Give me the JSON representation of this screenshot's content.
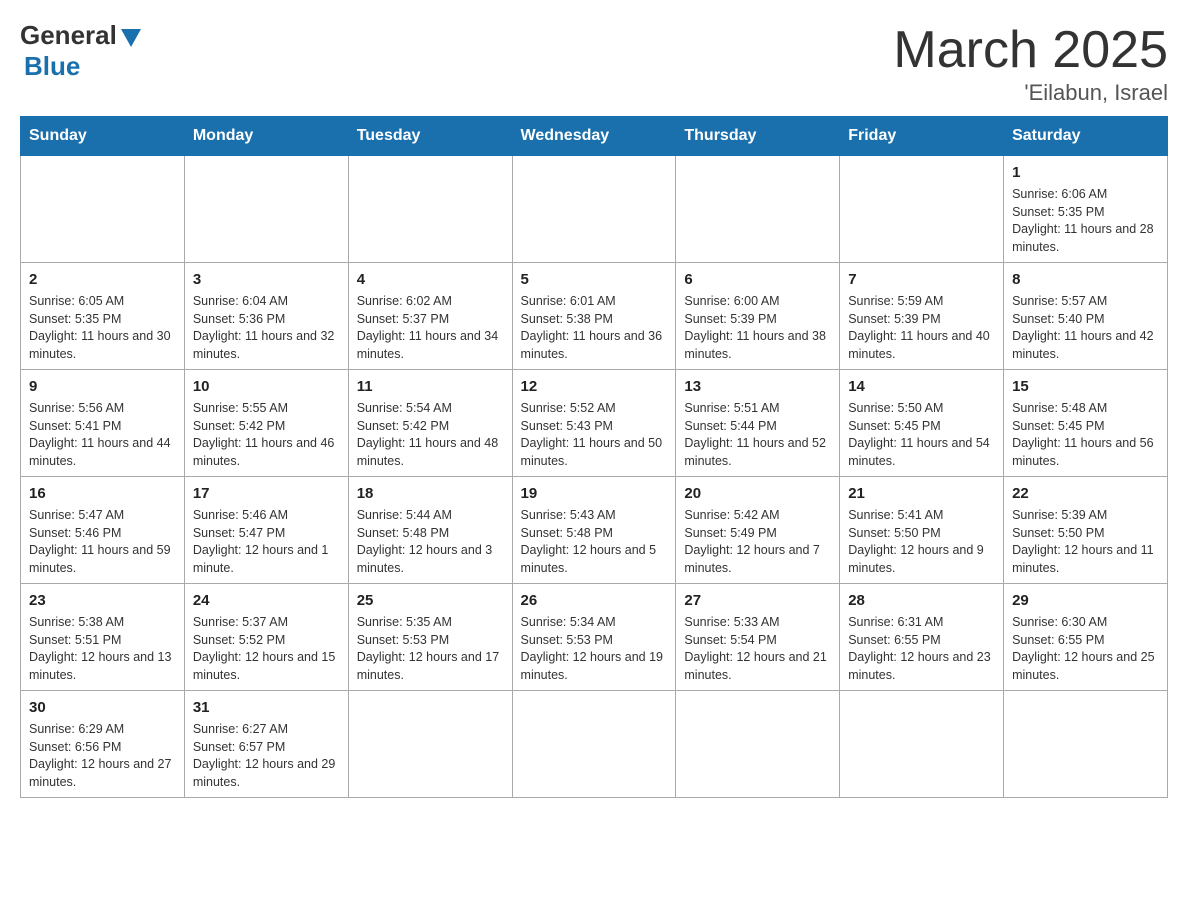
{
  "header": {
    "logo_general": "General",
    "logo_blue": "Blue",
    "month_title": "March 2025",
    "location": "'Eilabun, Israel"
  },
  "weekdays": [
    "Sunday",
    "Monday",
    "Tuesday",
    "Wednesday",
    "Thursday",
    "Friday",
    "Saturday"
  ],
  "weeks": [
    [
      {
        "day": "",
        "sunrise": "",
        "sunset": "",
        "daylight": ""
      },
      {
        "day": "",
        "sunrise": "",
        "sunset": "",
        "daylight": ""
      },
      {
        "day": "",
        "sunrise": "",
        "sunset": "",
        "daylight": ""
      },
      {
        "day": "",
        "sunrise": "",
        "sunset": "",
        "daylight": ""
      },
      {
        "day": "",
        "sunrise": "",
        "sunset": "",
        "daylight": ""
      },
      {
        "day": "",
        "sunrise": "",
        "sunset": "",
        "daylight": ""
      },
      {
        "day": "1",
        "sunrise": "Sunrise: 6:06 AM",
        "sunset": "Sunset: 5:35 PM",
        "daylight": "Daylight: 11 hours and 28 minutes."
      }
    ],
    [
      {
        "day": "2",
        "sunrise": "Sunrise: 6:05 AM",
        "sunset": "Sunset: 5:35 PM",
        "daylight": "Daylight: 11 hours and 30 minutes."
      },
      {
        "day": "3",
        "sunrise": "Sunrise: 6:04 AM",
        "sunset": "Sunset: 5:36 PM",
        "daylight": "Daylight: 11 hours and 32 minutes."
      },
      {
        "day": "4",
        "sunrise": "Sunrise: 6:02 AM",
        "sunset": "Sunset: 5:37 PM",
        "daylight": "Daylight: 11 hours and 34 minutes."
      },
      {
        "day": "5",
        "sunrise": "Sunrise: 6:01 AM",
        "sunset": "Sunset: 5:38 PM",
        "daylight": "Daylight: 11 hours and 36 minutes."
      },
      {
        "day": "6",
        "sunrise": "Sunrise: 6:00 AM",
        "sunset": "Sunset: 5:39 PM",
        "daylight": "Daylight: 11 hours and 38 minutes."
      },
      {
        "day": "7",
        "sunrise": "Sunrise: 5:59 AM",
        "sunset": "Sunset: 5:39 PM",
        "daylight": "Daylight: 11 hours and 40 minutes."
      },
      {
        "day": "8",
        "sunrise": "Sunrise: 5:57 AM",
        "sunset": "Sunset: 5:40 PM",
        "daylight": "Daylight: 11 hours and 42 minutes."
      }
    ],
    [
      {
        "day": "9",
        "sunrise": "Sunrise: 5:56 AM",
        "sunset": "Sunset: 5:41 PM",
        "daylight": "Daylight: 11 hours and 44 minutes."
      },
      {
        "day": "10",
        "sunrise": "Sunrise: 5:55 AM",
        "sunset": "Sunset: 5:42 PM",
        "daylight": "Daylight: 11 hours and 46 minutes."
      },
      {
        "day": "11",
        "sunrise": "Sunrise: 5:54 AM",
        "sunset": "Sunset: 5:42 PM",
        "daylight": "Daylight: 11 hours and 48 minutes."
      },
      {
        "day": "12",
        "sunrise": "Sunrise: 5:52 AM",
        "sunset": "Sunset: 5:43 PM",
        "daylight": "Daylight: 11 hours and 50 minutes."
      },
      {
        "day": "13",
        "sunrise": "Sunrise: 5:51 AM",
        "sunset": "Sunset: 5:44 PM",
        "daylight": "Daylight: 11 hours and 52 minutes."
      },
      {
        "day": "14",
        "sunrise": "Sunrise: 5:50 AM",
        "sunset": "Sunset: 5:45 PM",
        "daylight": "Daylight: 11 hours and 54 minutes."
      },
      {
        "day": "15",
        "sunrise": "Sunrise: 5:48 AM",
        "sunset": "Sunset: 5:45 PM",
        "daylight": "Daylight: 11 hours and 56 minutes."
      }
    ],
    [
      {
        "day": "16",
        "sunrise": "Sunrise: 5:47 AM",
        "sunset": "Sunset: 5:46 PM",
        "daylight": "Daylight: 11 hours and 59 minutes."
      },
      {
        "day": "17",
        "sunrise": "Sunrise: 5:46 AM",
        "sunset": "Sunset: 5:47 PM",
        "daylight": "Daylight: 12 hours and 1 minute."
      },
      {
        "day": "18",
        "sunrise": "Sunrise: 5:44 AM",
        "sunset": "Sunset: 5:48 PM",
        "daylight": "Daylight: 12 hours and 3 minutes."
      },
      {
        "day": "19",
        "sunrise": "Sunrise: 5:43 AM",
        "sunset": "Sunset: 5:48 PM",
        "daylight": "Daylight: 12 hours and 5 minutes."
      },
      {
        "day": "20",
        "sunrise": "Sunrise: 5:42 AM",
        "sunset": "Sunset: 5:49 PM",
        "daylight": "Daylight: 12 hours and 7 minutes."
      },
      {
        "day": "21",
        "sunrise": "Sunrise: 5:41 AM",
        "sunset": "Sunset: 5:50 PM",
        "daylight": "Daylight: 12 hours and 9 minutes."
      },
      {
        "day": "22",
        "sunrise": "Sunrise: 5:39 AM",
        "sunset": "Sunset: 5:50 PM",
        "daylight": "Daylight: 12 hours and 11 minutes."
      }
    ],
    [
      {
        "day": "23",
        "sunrise": "Sunrise: 5:38 AM",
        "sunset": "Sunset: 5:51 PM",
        "daylight": "Daylight: 12 hours and 13 minutes."
      },
      {
        "day": "24",
        "sunrise": "Sunrise: 5:37 AM",
        "sunset": "Sunset: 5:52 PM",
        "daylight": "Daylight: 12 hours and 15 minutes."
      },
      {
        "day": "25",
        "sunrise": "Sunrise: 5:35 AM",
        "sunset": "Sunset: 5:53 PM",
        "daylight": "Daylight: 12 hours and 17 minutes."
      },
      {
        "day": "26",
        "sunrise": "Sunrise: 5:34 AM",
        "sunset": "Sunset: 5:53 PM",
        "daylight": "Daylight: 12 hours and 19 minutes."
      },
      {
        "day": "27",
        "sunrise": "Sunrise: 5:33 AM",
        "sunset": "Sunset: 5:54 PM",
        "daylight": "Daylight: 12 hours and 21 minutes."
      },
      {
        "day": "28",
        "sunrise": "Sunrise: 6:31 AM",
        "sunset": "Sunset: 6:55 PM",
        "daylight": "Daylight: 12 hours and 23 minutes."
      },
      {
        "day": "29",
        "sunrise": "Sunrise: 6:30 AM",
        "sunset": "Sunset: 6:55 PM",
        "daylight": "Daylight: 12 hours and 25 minutes."
      }
    ],
    [
      {
        "day": "30",
        "sunrise": "Sunrise: 6:29 AM",
        "sunset": "Sunset: 6:56 PM",
        "daylight": "Daylight: 12 hours and 27 minutes."
      },
      {
        "day": "31",
        "sunrise": "Sunrise: 6:27 AM",
        "sunset": "Sunset: 6:57 PM",
        "daylight": "Daylight: 12 hours and 29 minutes."
      },
      {
        "day": "",
        "sunrise": "",
        "sunset": "",
        "daylight": ""
      },
      {
        "day": "",
        "sunrise": "",
        "sunset": "",
        "daylight": ""
      },
      {
        "day": "",
        "sunrise": "",
        "sunset": "",
        "daylight": ""
      },
      {
        "day": "",
        "sunrise": "",
        "sunset": "",
        "daylight": ""
      },
      {
        "day": "",
        "sunrise": "",
        "sunset": "",
        "daylight": ""
      }
    ]
  ]
}
